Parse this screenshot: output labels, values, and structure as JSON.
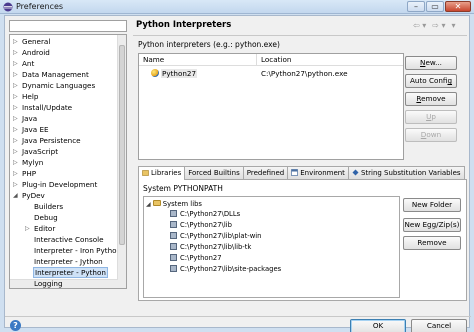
{
  "window": {
    "title": "Preferences",
    "controls": [
      "–",
      "▭",
      "✕"
    ]
  },
  "sidebar": {
    "filter_value": "",
    "items": [
      {
        "label": "General",
        "level": 0,
        "expandable": true
      },
      {
        "label": "Android",
        "level": 0,
        "expandable": true
      },
      {
        "label": "Ant",
        "level": 0,
        "expandable": true
      },
      {
        "label": "Data Management",
        "level": 0,
        "expandable": true
      },
      {
        "label": "Dynamic Languages",
        "level": 0,
        "expandable": true
      },
      {
        "label": "Help",
        "level": 0,
        "expandable": true
      },
      {
        "label": "Install/Update",
        "level": 0,
        "expandable": true
      },
      {
        "label": "Java",
        "level": 0,
        "expandable": true
      },
      {
        "label": "Java EE",
        "level": 0,
        "expandable": true
      },
      {
        "label": "Java Persistence",
        "level": 0,
        "expandable": true
      },
      {
        "label": "JavaScript",
        "level": 0,
        "expandable": true
      },
      {
        "label": "Mylyn",
        "level": 0,
        "expandable": true
      },
      {
        "label": "PHP",
        "level": 0,
        "expandable": true
      },
      {
        "label": "Plug-in Development",
        "level": 0,
        "expandable": true
      },
      {
        "label": "PyDev",
        "level": 0,
        "expandable": true,
        "expanded": true
      },
      {
        "label": "Builders",
        "level": 1
      },
      {
        "label": "Debug",
        "level": 1
      },
      {
        "label": "Editor",
        "level": 1,
        "expandable": true
      },
      {
        "label": "Interactive Console",
        "level": 1
      },
      {
        "label": "Interpreter - Iron Pytho",
        "level": 1
      },
      {
        "label": "Interpreter - Jython",
        "level": 1
      },
      {
        "label": "Interpreter - Python",
        "level": 1,
        "selected": true
      },
      {
        "label": "Logging",
        "level": 1
      }
    ]
  },
  "page": {
    "title": "Python Interpreters",
    "description": "Python interpreters (e.g.: python.exe)",
    "table": {
      "columns": [
        "Name",
        "Location"
      ],
      "rows": [
        [
          "Python27",
          "C:\\Python27\\python.exe"
        ]
      ]
    },
    "buttons": {
      "new": {
        "pre": "",
        "u": "N",
        "post": "ew..."
      },
      "auto_config": {
        "pre": "Auto Confi",
        "u": "g",
        "post": ""
      },
      "remove": {
        "pre": "",
        "u": "R",
        "post": "emove"
      },
      "up": {
        "pre": "",
        "u": "U",
        "post": "p"
      },
      "down": {
        "pre": "",
        "u": "D",
        "post": "own"
      }
    },
    "tabs": [
      "Libraries",
      "Forced Builtins",
      "Predefined",
      "Environment",
      "String Substitution Variables"
    ],
    "system_pythonpath_label": "System PYTHONPATH",
    "system_libs": {
      "label": "System libs",
      "entries": [
        "C:\\Python27\\DLLs",
        "C:\\Python27\\lib",
        "C:\\Python27\\lib\\plat-win",
        "C:\\Python27\\lib\\lib-tk",
        "C:\\Python27",
        "C:\\Python27\\lib\\site-packages"
      ]
    },
    "lib_buttons": {
      "new_folder": "New Folder",
      "new_egg": "New Egg/Zip(s)",
      "remove": "Remove"
    }
  },
  "footer": {
    "ok": "OK",
    "cancel": "Cancel"
  },
  "colors": {
    "selection": "#cfe2f7",
    "title_bar": "#c3d7ee",
    "dialog_bg": "#f0f0f0"
  }
}
